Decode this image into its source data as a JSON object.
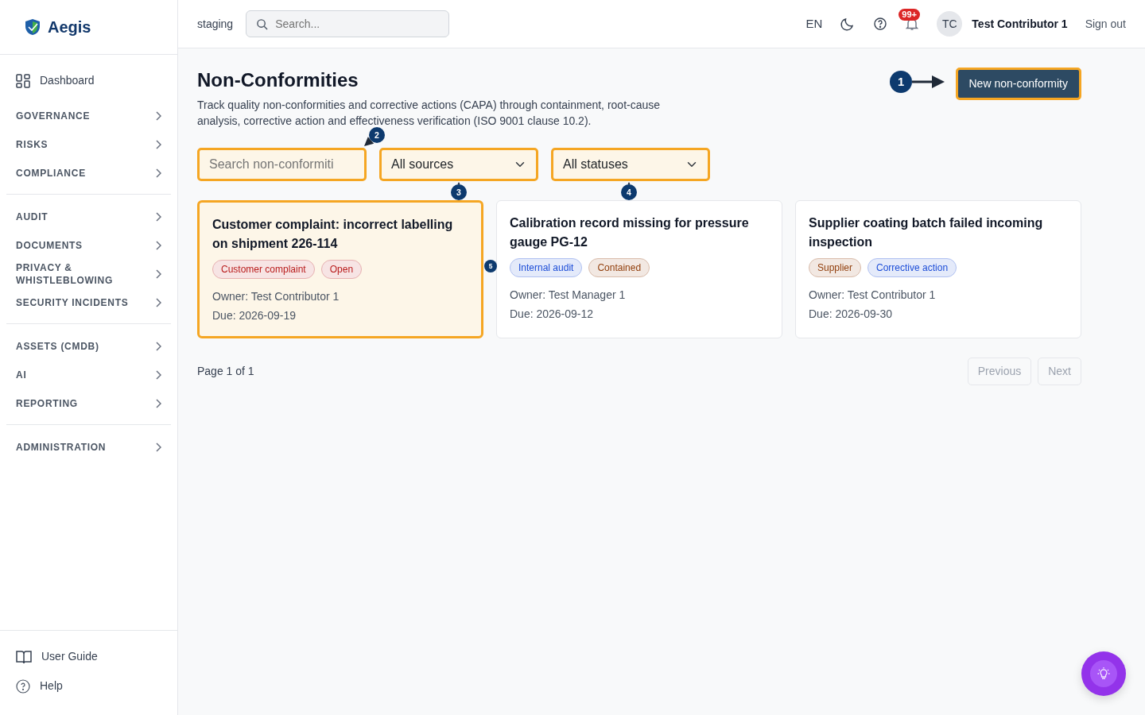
{
  "brand": {
    "name": "Aegis"
  },
  "sidebar": {
    "dashboard": {
      "label": "Dashboard"
    },
    "groups": [
      [
        {
          "label": "GOVERNANCE"
        },
        {
          "label": "RISKS"
        },
        {
          "label": "COMPLIANCE"
        }
      ],
      [
        {
          "label": "AUDIT"
        },
        {
          "label": "DOCUMENTS"
        },
        {
          "label": "PRIVACY & WHISTLEBLOWING"
        },
        {
          "label": "SECURITY INCIDENTS"
        }
      ],
      [
        {
          "label": "ASSETS (CMDB)"
        },
        {
          "label": "AI"
        },
        {
          "label": "REPORTING"
        }
      ],
      [
        {
          "label": "ADMINISTRATION"
        }
      ]
    ],
    "footer": [
      {
        "kind": "guide",
        "label": "User Guide"
      },
      {
        "kind": "help",
        "label": "Help"
      }
    ]
  },
  "topbar": {
    "environment": "staging",
    "search": {
      "placeholder": "Search..."
    },
    "language": "EN",
    "notifications": "99+",
    "user_initials": "TC",
    "user_name": "Test Contributor 1",
    "sign_out": "Sign out"
  },
  "page": {
    "title": "Non-Conformities",
    "description": "Track quality non-conformities and corrective actions (CAPA) through containment, root-cause analysis, corrective action and effectiveness verification (ISO 9001 clause 10.2).",
    "new_button": {
      "label": "New non-conformity",
      "highlighted": true
    }
  },
  "filters": {
    "search": {
      "placeholder": "Search non-conformiti",
      "highlighted": true
    },
    "source": {
      "value": "All sources",
      "highlighted": true
    },
    "status": {
      "value": "All statuses",
      "highlighted": true
    }
  },
  "cards": [
    {
      "title": "Customer complaint: incorrect labelling on shipment 226-114",
      "highlighted": true,
      "tags": [
        {
          "label": "Customer complaint",
          "color": "#b91c1c"
        },
        {
          "label": "Open",
          "color": "#b91c1c"
        }
      ],
      "owner": "Owner: Test Contributor 1",
      "due": "Due: 2026-09-19"
    },
    {
      "title": "Calibration record missing for pressure gauge PG-12",
      "highlighted": false,
      "tags": [
        {
          "label": "Internal audit",
          "color": "#1d4ed8"
        },
        {
          "label": "Contained",
          "color": "#92400e"
        }
      ],
      "owner": "Owner: Test Manager 1",
      "due": "Due: 2026-09-12"
    },
    {
      "title": "Supplier coating batch failed incoming inspection",
      "highlighted": false,
      "tags": [
        {
          "label": "Supplier",
          "color": "#92400e"
        },
        {
          "label": "Corrective action",
          "color": "#1d4ed8"
        }
      ],
      "owner": "Owner: Test Contributor 1",
      "due": "Due: 2026-09-30"
    }
  ],
  "pagination": {
    "info": "Page 1 of 1",
    "previous": {
      "label": "Previous",
      "disabled": true
    },
    "next": {
      "label": "Next",
      "disabled": true
    }
  },
  "annotations": [
    {
      "label": "1"
    },
    {
      "label": "2"
    },
    {
      "label": "3"
    },
    {
      "label": "4"
    },
    {
      "label": "5"
    }
  ]
}
